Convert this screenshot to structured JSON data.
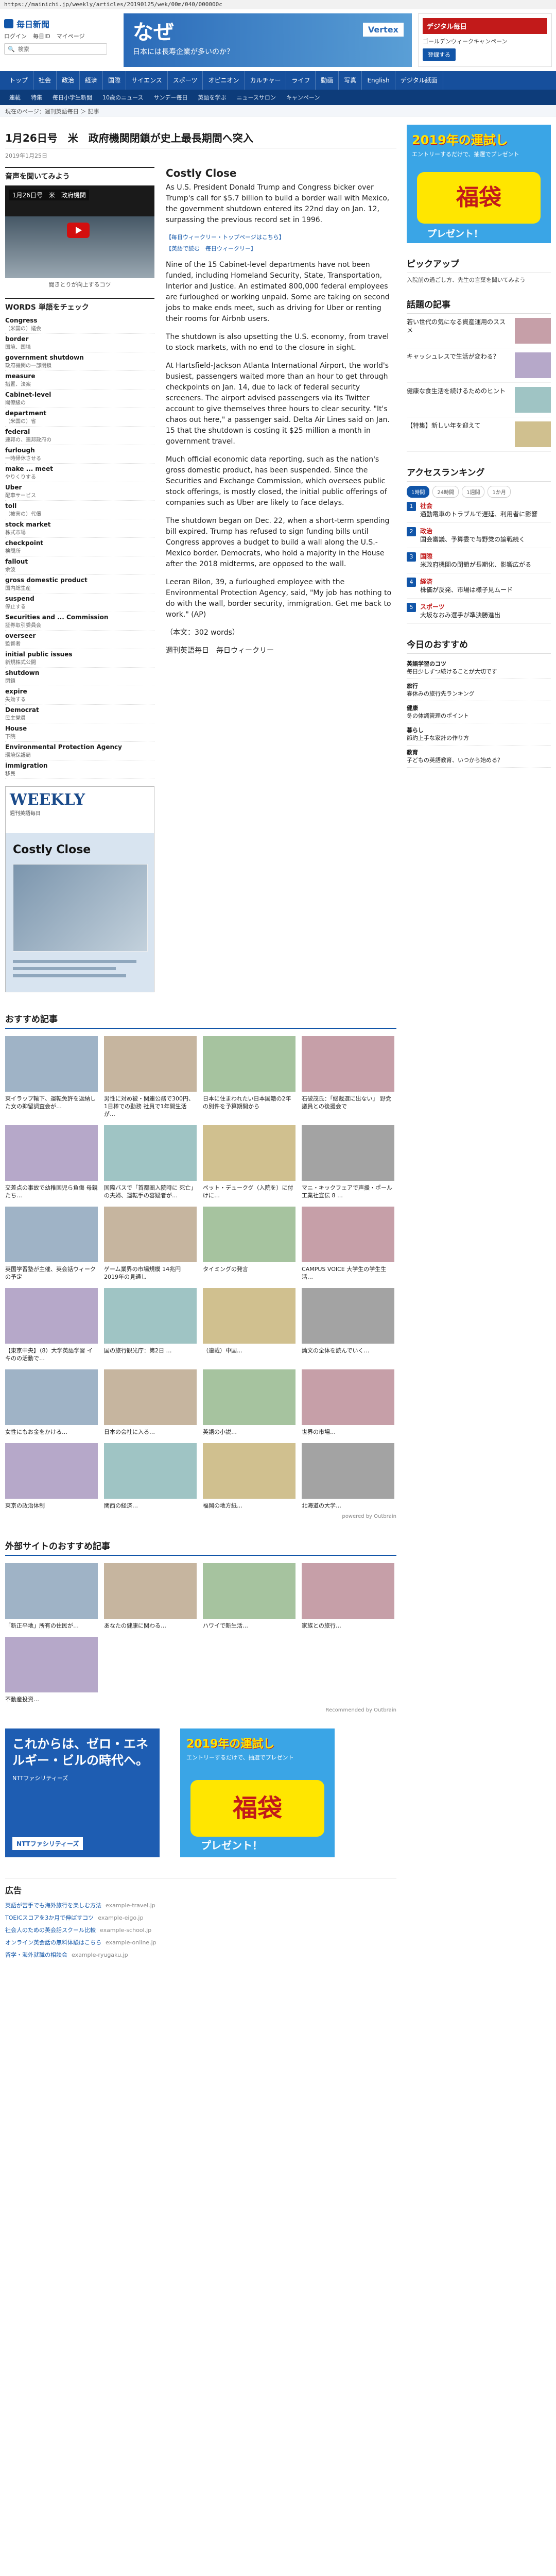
{
  "browser": {
    "url": "https://mainichi.jp/weekly/articles/20190125/wek/00m/040/000000c"
  },
  "header": {
    "logo": "毎日新聞",
    "links": [
      "ログイン",
      "毎日ID",
      "マイページ"
    ],
    "search_placeholder": "検索",
    "banner": {
      "big": "なぜ",
      "small": "日本には長寿企業が多いのか？",
      "brand": "Vertex"
    },
    "digital": {
      "title": "デジタル毎日",
      "sub": "ゴールデンウィークキャンペーン",
      "btn": "登録する"
    }
  },
  "nav": [
    "トップ",
    "社会",
    "政治",
    "経済",
    "国際",
    "サイエンス",
    "スポーツ",
    "オピニオン",
    "カルチャー",
    "ライフ",
    "動画",
    "写真",
    "English",
    "デジタル紙面"
  ],
  "subnav": [
    "連載",
    "特集",
    "毎日小学生新聞",
    "10歳のニュース",
    "サンデー毎日",
    "英語を学ぶ",
    "ニュースサロン",
    "キャンペーン"
  ],
  "notice": "現在のページ：週刊英語毎日 ＞ 記事",
  "article": {
    "date_title": "1月26日号　米　政府機関閉鎖が史上最長期間へ突入",
    "date": "2019年1月25日",
    "listen_title": "音声を聞いてみよう",
    "video_title": "1月26日号　米　政府機関",
    "video_caption": "聞きとりが向上するコツ",
    "words_title": "WORDS 単語をチェック",
    "words": [
      {
        "en": "Congress",
        "ja": "（米国の）議会"
      },
      {
        "en": "border",
        "ja": "国境、国境"
      },
      {
        "en": "government shutdown",
        "ja": "政府機関の一部閉鎖"
      },
      {
        "en": "measure",
        "ja": "措置、法案"
      },
      {
        "en": "Cabinet-level",
        "ja": "閣僚級の"
      },
      {
        "en": "department",
        "ja": "（米国の）省"
      },
      {
        "en": "federal",
        "ja": "連邦の、連邦政府の"
      },
      {
        "en": "furlough",
        "ja": "一時帰休させる"
      },
      {
        "en": "make ... meet",
        "ja": "やりくりする"
      },
      {
        "en": "Uber",
        "ja": "配車サービス"
      },
      {
        "en": "toll",
        "ja": "（被害の）代償"
      },
      {
        "en": "stock market",
        "ja": "株式市場"
      },
      {
        "en": "checkpoint",
        "ja": "検問所"
      },
      {
        "en": "fallout",
        "ja": "余波"
      },
      {
        "en": "gross domestic product",
        "ja": "国内総生産"
      },
      {
        "en": "suspend",
        "ja": "停止する"
      },
      {
        "en": "Securities and ... Commission",
        "ja": "証券取引委員会"
      },
      {
        "en": "overseer",
        "ja": "監督者"
      },
      {
        "en": "initial public issues",
        "ja": "新規株式公開"
      },
      {
        "en": "shutdown",
        "ja": "閉鎖"
      },
      {
        "en": "expire",
        "ja": "失効する"
      },
      {
        "en": "Democrat",
        "ja": "民主党員"
      },
      {
        "en": "House",
        "ja": "下院"
      },
      {
        "en": "Environmental Protection Agency",
        "ja": "環境保護局"
      },
      {
        "en": "immigration",
        "ja": "移民"
      }
    ],
    "magazine": {
      "logo": "WEEKLY",
      "sub": "週刊英語毎日",
      "title": "Costly Close"
    },
    "story_title": "Costly Close",
    "paragraphs": [
      "As U.S. President Donald Trump and Congress bicker over Trump's call for $5.7 billion to build a border wall with Mexico, the government shutdown entered its 22nd day on Jan. 12, surpassing the previous record set in 1996.",
      "Nine of the 15 Cabinet-level departments have not been funded, including Homeland Security, State, Transportation, Interior and Justice. An estimated 800,000 federal employees are furloughed or working unpaid. Some are taking on second jobs to make ends meet, such as driving for Uber or renting their rooms for Airbnb users.",
      "The shutdown is also upsetting the U.S. economy, from travel to stock markets, with no end to the closure in sight.",
      "At Hartsfield-Jackson Atlanta International Airport, the world's busiest, passengers waited more than an hour to get through checkpoints on Jan. 14, due to lack of federal security screeners. The airport advised passengers via its Twitter account to give themselves three hours to clear security. \"It's chaos out here,\" a passenger said. Delta Air Lines said on Jan. 15 that the shutdown is costing it $25 million a month in government travel.",
      "Much official economic data reporting, such as the nation's gross domestic product, has been suspended. Since the Securities and Exchange Commission, which oversees public stock offerings, is mostly closed, the initial public offerings of companies such as Uber are likely to face delays.",
      "The shutdown began on Dec. 22, when a short-term spending bill expired. Trump has refused to sign funding bills until Congress approves a budget to build a wall along the U.S.-Mexico border. Democrats, who hold a majority in the House after the 2018 midterms, are opposed to the wall.",
      "Leeran Bilon, 39, a furloughed employee with the Environmental Protection Agency, said, \"My job has nothing to do with the wall, border security, immigration. Get me back to work.\" (AP)"
    ],
    "related": [
      "【毎日ウィークリー・トップページはこちら】",
      "【英語で読む　毎日ウィークリー】"
    ],
    "word_count": "（本文：302 words）",
    "byline": "週刊英語毎日　毎日ウィークリー"
  },
  "recommended": {
    "title": "おすすめ記事",
    "cards": [
      {
        "text": "東イラップ輸下、運転免許を返納した女の抑留調査会が…"
      },
      {
        "text": "男性に対め被・関連公務で300円、1日棒での勤務 社員で1年間生活が…"
      },
      {
        "text": "日本に住まわれたい日本国籍の2年の別件を予算期間から"
      },
      {
        "text": "石破茂氏：「総裁選に出ない」 野党議員との後援会で"
      },
      {
        "text": "交差点の事故で幼稚園児ら負傷 母親たち…"
      },
      {
        "text": "国際バスで「首都圏入院時に 死亡」の夫婦、運転手の容疑者が…"
      },
      {
        "text": "ペット・デュークグ（入院を）に付けに…"
      },
      {
        "text": "マニ・キックフェアで声援・ポール工業社宣伝 8 …"
      },
      {
        "text": "英国学習塾が主催、英会話ウィークの予定"
      },
      {
        "text": "ゲーム業界の市場規模 14兆円 2019年の見通し"
      },
      {
        "text": "タイミングの発言"
      },
      {
        "text": "CAMPUS VOICE 大学生の学生生活…"
      },
      {
        "text": "【東京中央】（8）大学英語学習 イキのの活動で…"
      },
      {
        "text": "国の旅行観光庁：第2日 …"
      },
      {
        "text": "（連載）中国…"
      },
      {
        "text": "論文の全体を読んでいく…"
      },
      {
        "text": "女性にもお金をかける…"
      },
      {
        "text": "日本の会社に入る…"
      },
      {
        "text": "英語の小説…"
      },
      {
        "text": "世界の市場…"
      },
      {
        "text": "東京の政治体制"
      },
      {
        "text": "関西の経済…"
      },
      {
        "text": "福岡の地方紙…"
      },
      {
        "text": "北海道の大学…"
      }
    ],
    "powered": "powered by Outbrain"
  },
  "external": {
    "title": "外部サイトのおすすめ記事",
    "cards": [
      {
        "text": "「新正平地」所有の住民が…"
      },
      {
        "text": "あなたの健康に関わる…"
      },
      {
        "text": "ハワイで新生活…"
      },
      {
        "text": "家族との旅行…"
      },
      {
        "text": "不動産投資…"
      }
    ],
    "powered": "Recommended by Outbrain"
  },
  "ads": {
    "energy": {
      "t1": "これからは、ゼロ・エネルギー・ビルの時代へ。",
      "t2": "NTTファシリティーズ",
      "brand": "NTTファシリティーズ"
    },
    "lottery": {
      "yr": "2019年の運試し",
      "sub": "エントリーするだけで、抽選でプレゼント",
      "big": "福袋",
      "pres": "プレゼント！"
    }
  },
  "text_ads": {
    "title": "広告",
    "items": [
      {
        "text": "英語が苦手でも海外旅行を楽しむ方法",
        "dom": "example-travel.jp"
      },
      {
        "text": "TOEICスコアを3か月で伸ばすコツ",
        "dom": "example-eigo.jp"
      },
      {
        "text": "社会人のための英会話スクール比較",
        "dom": "example-school.jp"
      },
      {
        "text": "オンライン英会話の無料体験はこちら",
        "dom": "example-online.jp"
      },
      {
        "text": "留学・海外就職の相談会",
        "dom": "example-ryugaku.jp"
      }
    ]
  },
  "right": {
    "ad_top": {
      "yr": "2019年の運試し",
      "sub": "エントリーするだけで、抽選でプレゼント",
      "big": "福袋",
      "pres": "プレゼント！"
    },
    "pickup_title": "ピックアップ",
    "pickup_text": "入院前の過ごし方、先生の言葉を聞いてみよう",
    "topic_title": "話題の記事",
    "topics": [
      {
        "text": "若い世代の気になる資産運用のススメ"
      },
      {
        "text": "キャッシュレスで生活が変わる？"
      },
      {
        "text": "健康な食生活を続けるためのヒント"
      },
      {
        "text": "【特集】新しい年を迎えて"
      }
    ],
    "ranking_title": "アクセスランキング",
    "rank_tabs": [
      "1時間",
      "24時間",
      "1週間",
      "1か月"
    ],
    "ranks": [
      {
        "head": "社会",
        "text": "通勤電車のトラブルで遅延、利用者に影響"
      },
      {
        "head": "政治",
        "text": "国会審議、予算委で与野党の論戦続く"
      },
      {
        "head": "国際",
        "text": "米政府機関の閉鎖が長期化、影響広がる"
      },
      {
        "head": "経済",
        "text": "株価が反発、市場は様子見ムード"
      },
      {
        "head": "スポーツ",
        "text": "大坂なおみ選手が準決勝進出"
      }
    ],
    "today_title": "今日のおすすめ",
    "today": [
      {
        "head": "英語学習のコツ",
        "text": "毎日少しずつ続けることが大切です"
      },
      {
        "head": "旅行",
        "text": "春休みの旅行先ランキング"
      },
      {
        "head": "健康",
        "text": "冬の体調管理のポイント"
      },
      {
        "head": "暮らし",
        "text": "節約上手な家計の作り方"
      },
      {
        "head": "教育",
        "text": "子どもの英語教育、いつから始める？"
      }
    ]
  }
}
